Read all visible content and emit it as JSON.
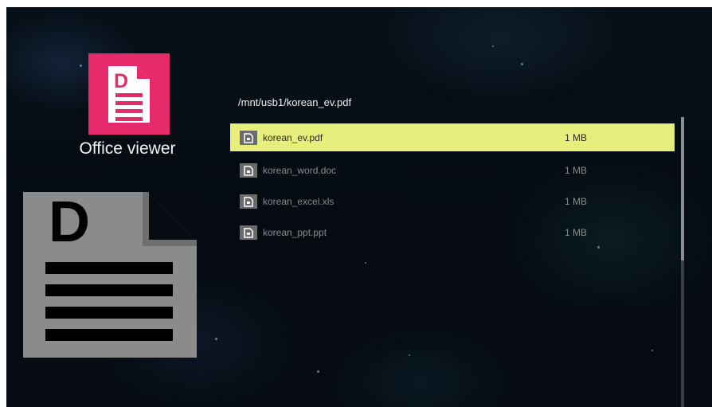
{
  "app": {
    "title": "Office viewer",
    "icon": "document-icon",
    "icon_letter": "D",
    "accent_color": "#e52b6c"
  },
  "browser": {
    "path": "/mnt/usb1/korean_ev.pdf",
    "files": [
      {
        "name": "korean_ev.pdf",
        "size": "1 MB",
        "icon": "file-icon",
        "selected": true
      },
      {
        "name": "korean_word.doc",
        "size": "1 MB",
        "icon": "file-icon",
        "selected": false
      },
      {
        "name": "korean_excel.xls",
        "size": "1 MB",
        "icon": "file-icon",
        "selected": false
      },
      {
        "name": "korean_ppt.ppt",
        "size": "1 MB",
        "icon": "file-icon",
        "selected": false
      }
    ],
    "highlight_color": "#e8ee7c"
  }
}
